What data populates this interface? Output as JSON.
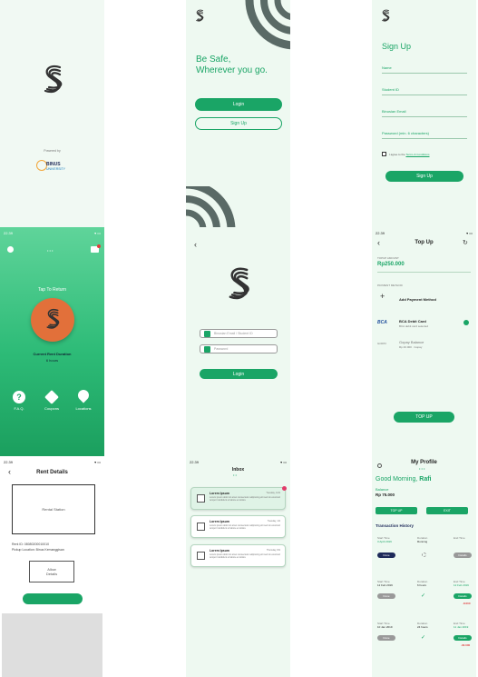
{
  "splash": {
    "powered_by": "Powered by",
    "university_line1": "BINUS",
    "university_line2": "UNIVERSITY"
  },
  "landing": {
    "tagline_line1": "Be Safe,",
    "tagline_line2": "Wherever you go.",
    "login_label": "Login",
    "signup_label": "Sign Up"
  },
  "signup": {
    "title": "Sign Up",
    "fields": [
      "Name",
      "Student ID",
      "Binusian Email",
      "Password (min. 6 characters)"
    ],
    "terms_prefix": "I agree to the",
    "terms_link": "Terms & Conditions",
    "submit_label": "Sign Up"
  },
  "home": {
    "time": "22.39",
    "tap_label": "Tap To Return",
    "duration_label": "Current Rent Duration",
    "duration_value": "6 hours",
    "nav": [
      "F.A.Q.",
      "Coupons",
      "Locations"
    ]
  },
  "login": {
    "email_placeholder": "Binusian Email / Student ID",
    "password_placeholder": "Password",
    "login_label": "Login"
  },
  "topup": {
    "time": "22.39",
    "title": "Top Up",
    "amount_label": "TOPUP AMOUNT",
    "amount_value": "Rp250.000",
    "methods_label": "PAYMENT METHOD",
    "add_method": "Add Payment Method",
    "bca_name": "BCA Debit Card",
    "bca_sub": "BCA debit card selected",
    "gopay_name": "Gopay Balance",
    "gopay_sub": "Rp 40.000 · Gopay",
    "submit_label": "TOP UP"
  },
  "rent": {
    "time": "22.39",
    "title": "Rent Details",
    "image_label": "Rental Station",
    "rent_id": "Rent ID: 08080200010010",
    "pickup": "Pickup Location: Binus Kemanggisan",
    "box_label_line1": "Allow",
    "box_label_line2": "Details"
  },
  "inbox": {
    "time": "22.39",
    "title": "Inbox",
    "messages": [
      {
        "title": "Lorem Ipsum",
        "date": "Tuesday, 12/2",
        "body": "Lorem ipsum dolor sit amet consectetur adipiscing elit sed do eiusmod tempor incididunt ut labore et dolore"
      },
      {
        "title": "Lorem Ipsum",
        "date": "Tuesday, 1/2",
        "body": "Lorem ipsum dolor sit amet consectetur adipiscing elit sed do eiusmod tempor incididunt ut labore et dolore"
      },
      {
        "title": "Lorem Ipsum",
        "date": "Thursday, 8/2",
        "body": "Lorem ipsum dolor sit amet consectetur adipiscing elit sed do eiusmod tempor incididunt ut labore et dolore"
      }
    ]
  },
  "profile": {
    "title": "My Profile",
    "greeting_prefix": "Good Morning,",
    "greeting_name": "Rafi",
    "balance_label": "Balance",
    "balance_value": "Rp 75.000",
    "topup_label": "TOP UP",
    "exit_label": "EXIT",
    "history_title": "Transaction History",
    "transactions": [
      {
        "start_label": "Start Time",
        "start": "3 April 2019",
        "duration_label": "Duration",
        "duration": "Running",
        "end_label": "End Time",
        "end": "",
        "left_btn": "Done",
        "right_btn": "Details",
        "fee": ""
      },
      {
        "start_label": "Start Time",
        "start": "12 Feb 2019",
        "duration_label": "Duration",
        "duration": "6 hours",
        "end_label": "End Time",
        "end": "12 Feb 2019",
        "left_btn": "Done",
        "right_btn": "Details",
        "fee": "-8.000"
      },
      {
        "start_label": "Start Time",
        "start": "10 Jan 2019",
        "duration_label": "Duration",
        "duration": "24 hours",
        "end_label": "End Time",
        "end": "11 Jan 2019",
        "left_btn": "Done",
        "right_btn": "Details",
        "fee": "-30.000"
      }
    ]
  },
  "colors": {
    "primary": "#1aa566",
    "dark_arc": "#5a6a66",
    "orange": "#e2703a",
    "navy": "#1e2a5a"
  }
}
